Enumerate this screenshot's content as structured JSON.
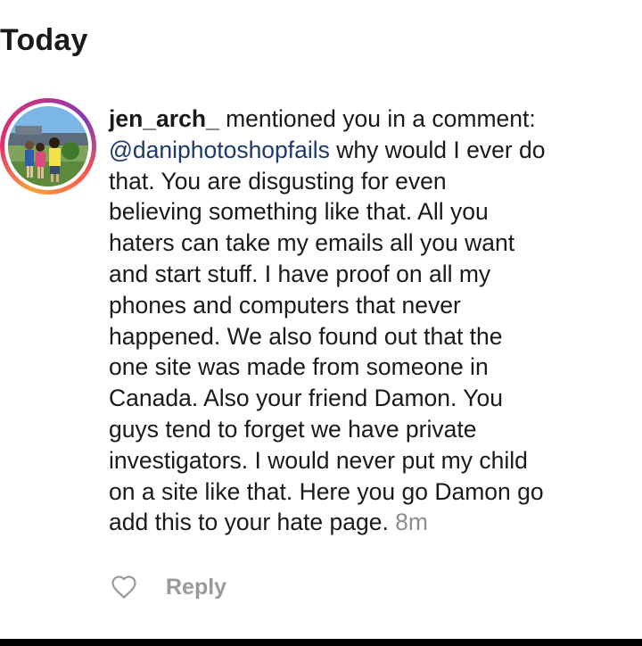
{
  "section": {
    "title": "Today"
  },
  "notification": {
    "avatar_icon": "profile-photo",
    "username": "jen_arch_",
    "action_text": " mentioned you in a comment:",
    "mention": "@daniphotoshopfails",
    "text_after_mention": " why would I ever do",
    "comment_lines": [
      "that.  You are disgusting for even",
      "believing something like that.  All you",
      "haters can take my emails all you want",
      "and start stuff.  I have proof on all my",
      "phones and computers that never",
      "happened.  We also found out that the",
      "one site was made from someone in",
      "Canada.  Also your friend Damon.  You",
      "guys tend to forget we have private",
      "investigators.  I would never put my child",
      "on a site like that.  Here you go Damon go"
    ],
    "last_line": "add this to your hate page. ",
    "timestamp": "8m"
  },
  "actions": {
    "like_icon": "heart-outline",
    "reply_label": "Reply"
  },
  "colors": {
    "mention": "#1d3a6b",
    "timestamp": "#8e8e8e",
    "reply": "#9a9a9a"
  }
}
